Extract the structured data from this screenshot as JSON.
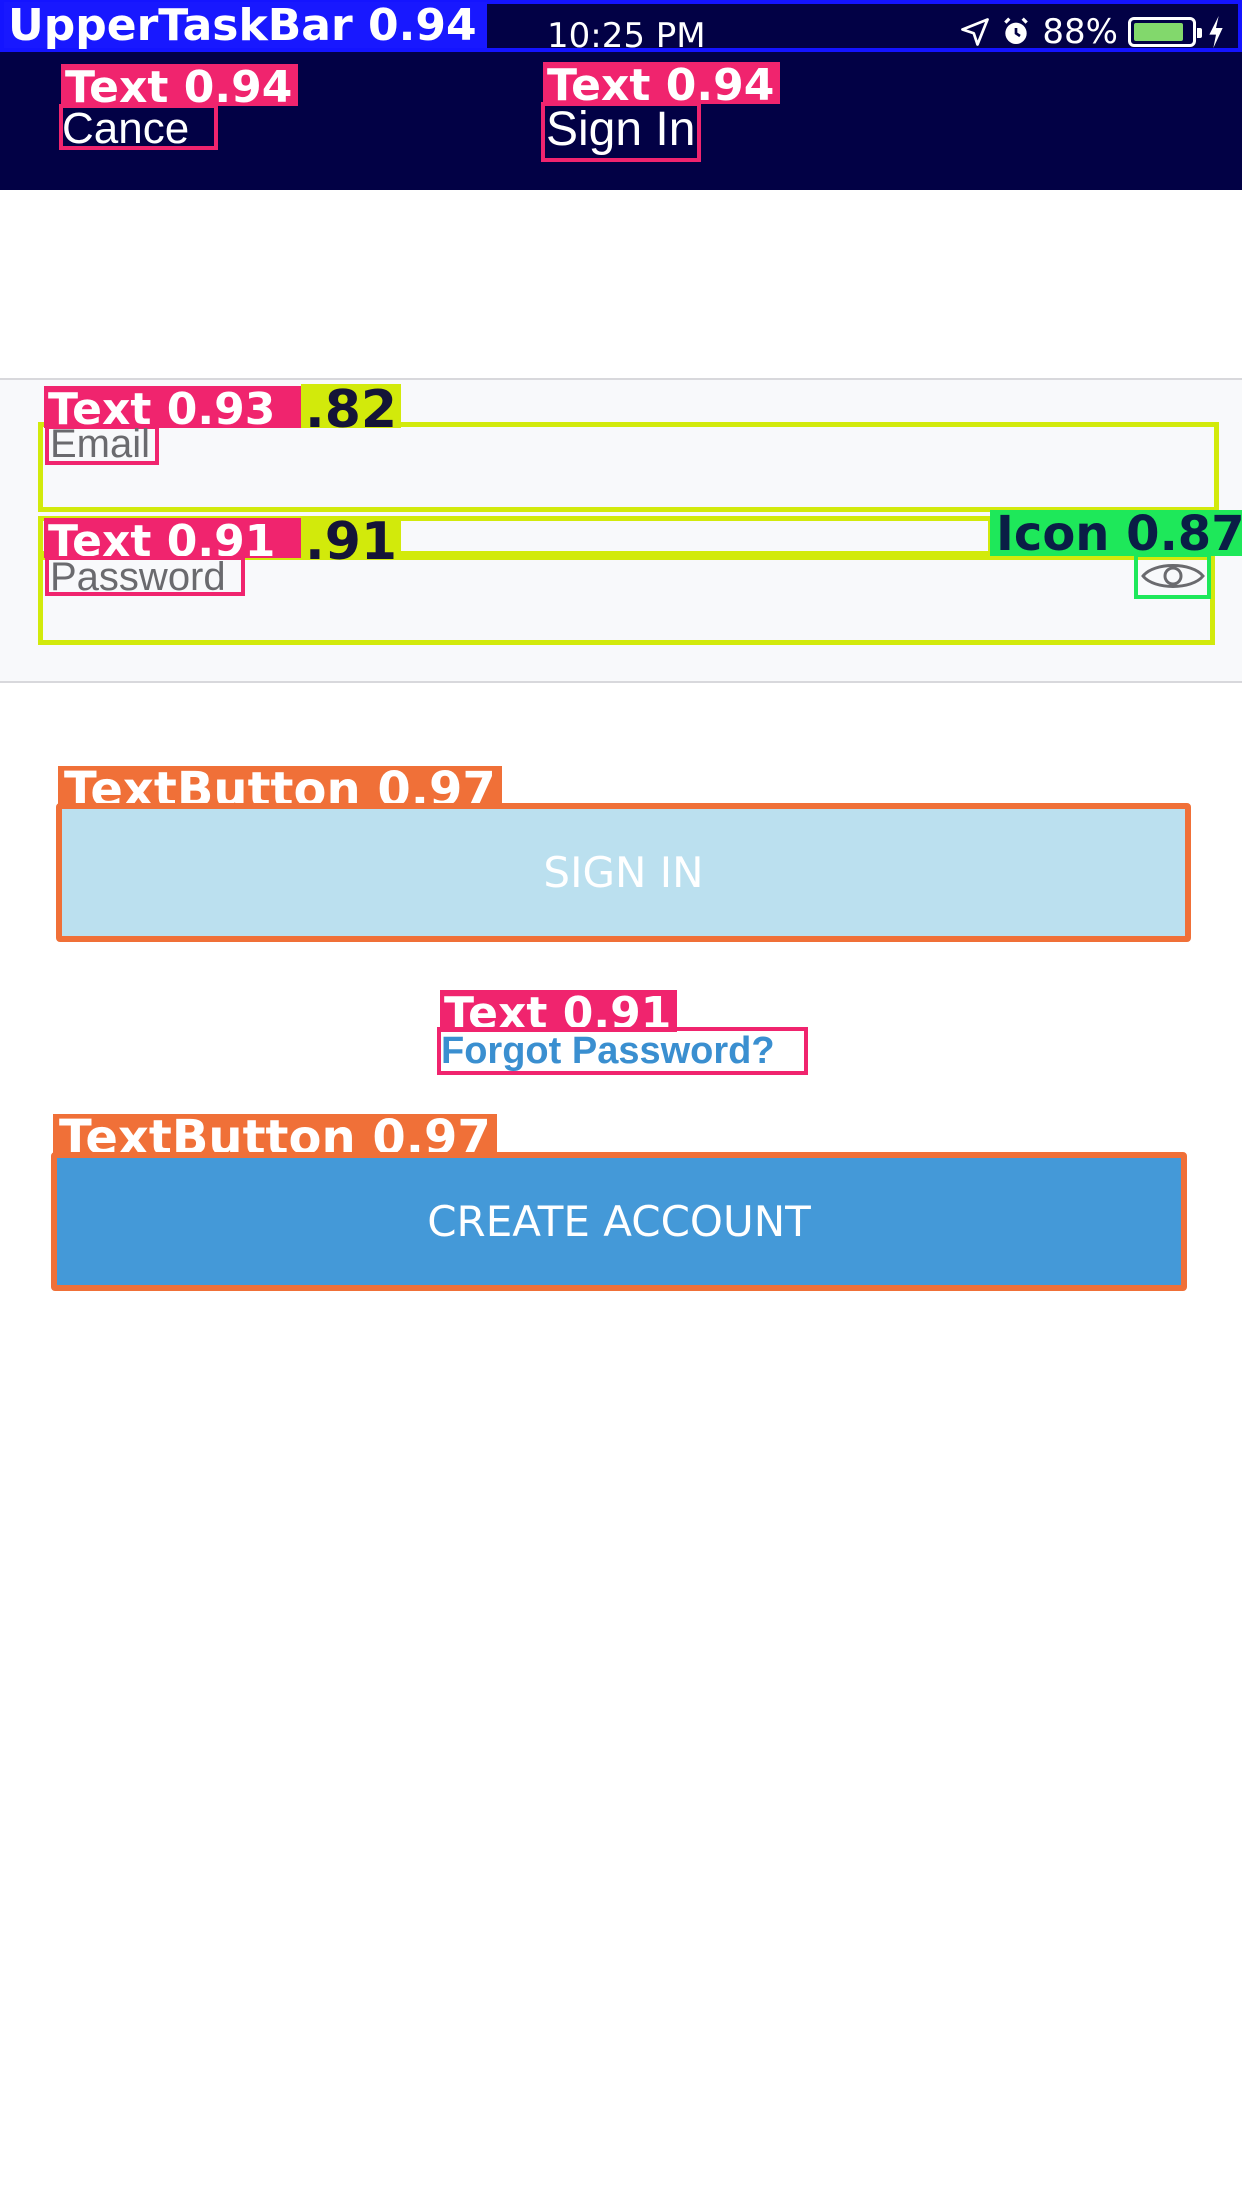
{
  "status_bar": {
    "time": "10:25 PM",
    "battery_percent": "88%",
    "battery_level": 0.88,
    "icons": [
      "location-arrow-icon",
      "alarm-clock-icon",
      "battery-icon",
      "charging-bolt-icon"
    ]
  },
  "nav": {
    "cancel_label": "Cance",
    "title": "Sign In"
  },
  "form": {
    "email_label": "Email",
    "password_label": "Password",
    "password_toggle_icon": "eye-icon"
  },
  "actions": {
    "sign_in_label": "SIGN IN",
    "forgot_password_label": "Forgot Password?",
    "create_account_label": "CREATE ACCOUNT"
  },
  "detections": {
    "upper_task_bar": "UpperTaskBar 0.94",
    "cancel_text": "Text 0.94",
    "title_text": "Text 0.94",
    "email_text": "Text 0.93",
    "email_field": ".82",
    "password_text": "Text 0.91",
    "password_field": ".91",
    "eye_icon": "Icon 0.87",
    "sign_in_button": "TextButton 0.97",
    "forgot_text": "Text 0.91",
    "create_button": "TextButton 0.97"
  },
  "colors": {
    "header_bg": "#020145",
    "sign_in_bg": "#bbe0ef",
    "create_account_bg": "#4499d8",
    "link": "#3a8fd0",
    "text_box": "#f0246e",
    "field_box": "#d2ea0b",
    "icon_box": "#1ee85a",
    "button_box": "#f07038",
    "taskbar_box": "#1414ff"
  }
}
